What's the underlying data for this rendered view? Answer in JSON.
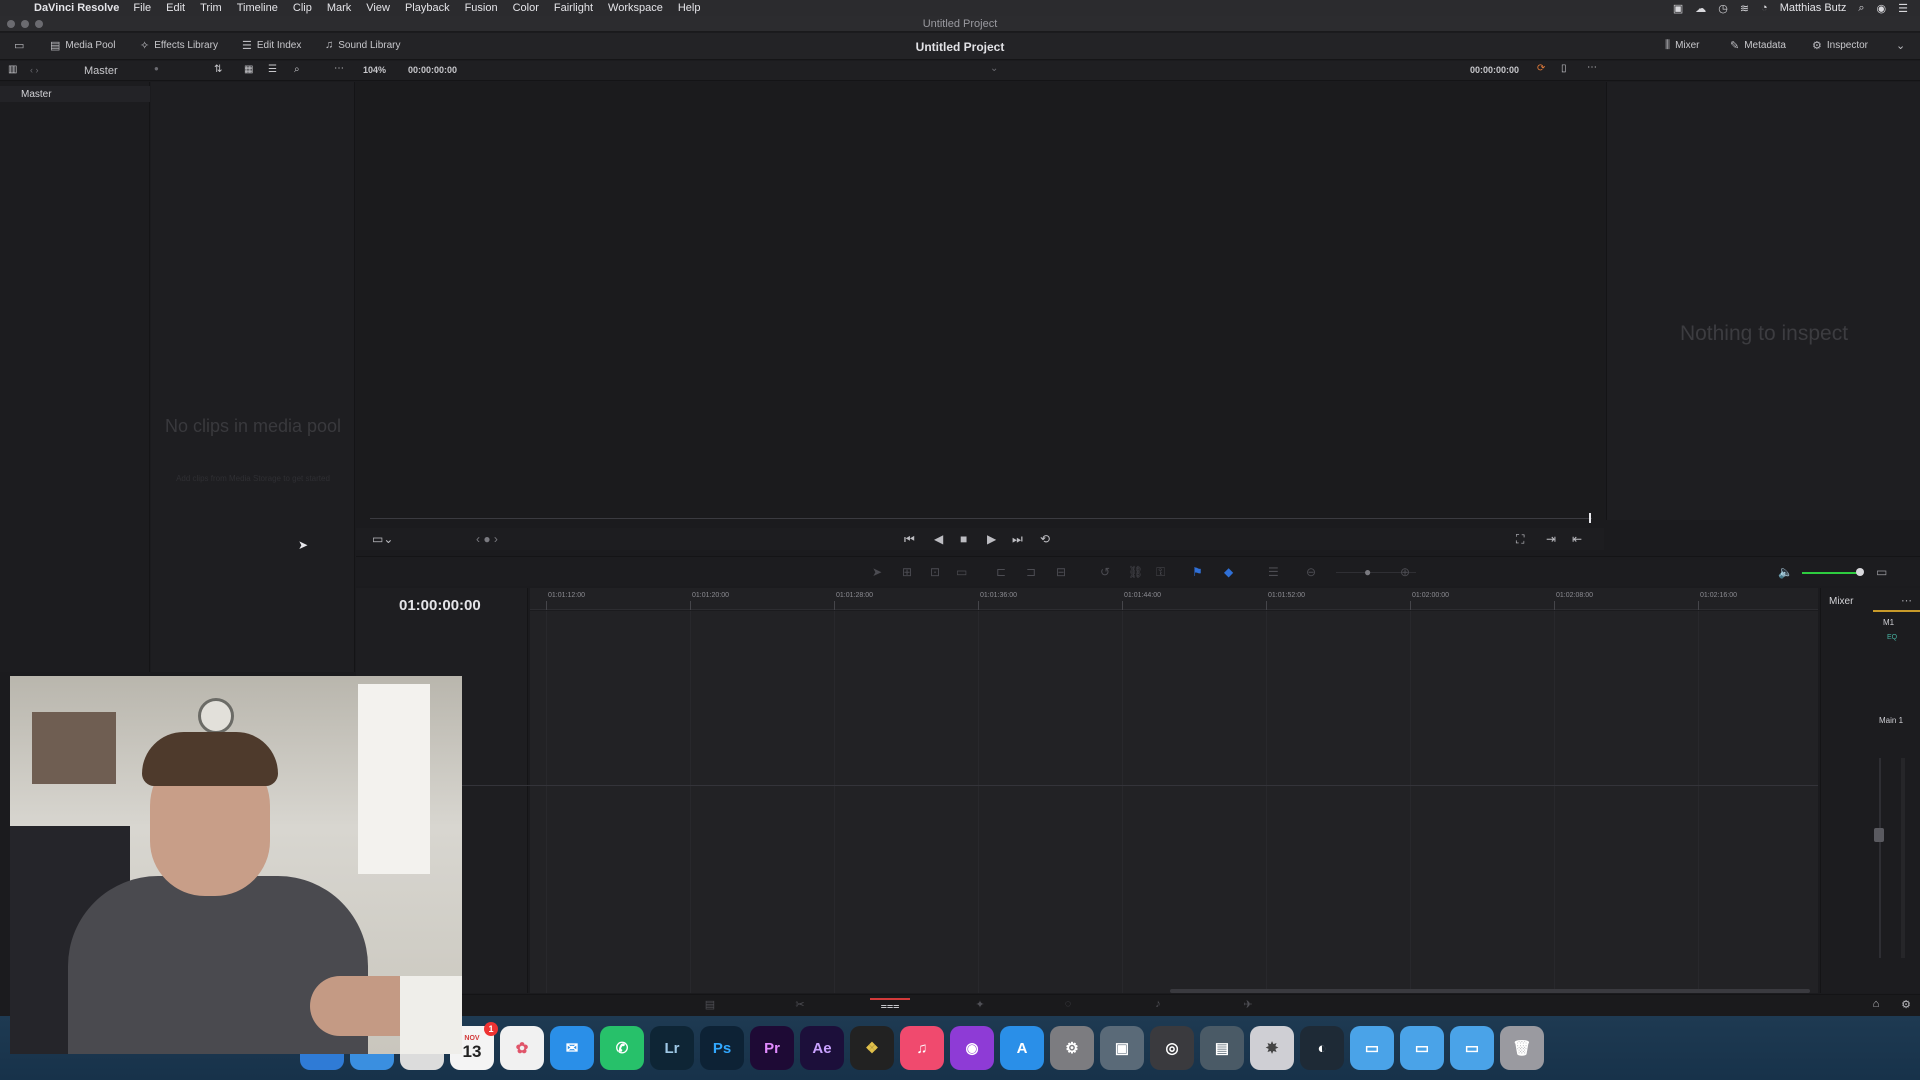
{
  "menubar": {
    "app_name": "DaVinci Resolve",
    "items": [
      "File",
      "Edit",
      "Trim",
      "Timeline",
      "Clip",
      "Mark",
      "View",
      "Playback",
      "Fusion",
      "Color",
      "Fairlight",
      "Workspace",
      "Help"
    ],
    "user": "Matthias Butz"
  },
  "window": {
    "title": "Untitled Project"
  },
  "toolbar": {
    "media_pool": "Media Pool",
    "effects_library": "Effects Library",
    "edit_index": "Edit Index",
    "sound_library": "Sound Library",
    "project_title": "Untitled Project",
    "mixer": "Mixer",
    "metadata": "Metadata",
    "inspector": "Inspector"
  },
  "subbar": {
    "bin": "Master",
    "zoom": "104%",
    "source_timecode": "00:00:00:00",
    "viewer_timecode": "00:00:00:00"
  },
  "bins": {
    "master": "Master"
  },
  "media_pool": {
    "empty_text": "No clips in media pool",
    "hint": "Add clips from Media Storage to get started"
  },
  "inspector": {
    "empty_text": "Nothing to inspect"
  },
  "timeline": {
    "timecode": "01:00:00:00",
    "ruler": [
      "01:01:12:00",
      "01:01:20:00",
      "01:01:28:00",
      "01:01:36:00",
      "01:01:44:00",
      "01:01:52:00",
      "01:02:00:00",
      "01:02:08:00",
      "01:02:16:00"
    ]
  },
  "mixer": {
    "title": "Mixer",
    "track": "M1",
    "eq": "EQ",
    "main": "Main 1"
  },
  "dock": {
    "calendar_month": "NOV",
    "calendar_day": "13",
    "calendar_badge": "1",
    "apps": [
      "Lr",
      "Ps",
      "Pr",
      "Ae"
    ]
  },
  "colors": {
    "accent_red": "#d33a3a",
    "meter_green": "#2ecc40",
    "mixer_gold": "#c89a2a"
  }
}
